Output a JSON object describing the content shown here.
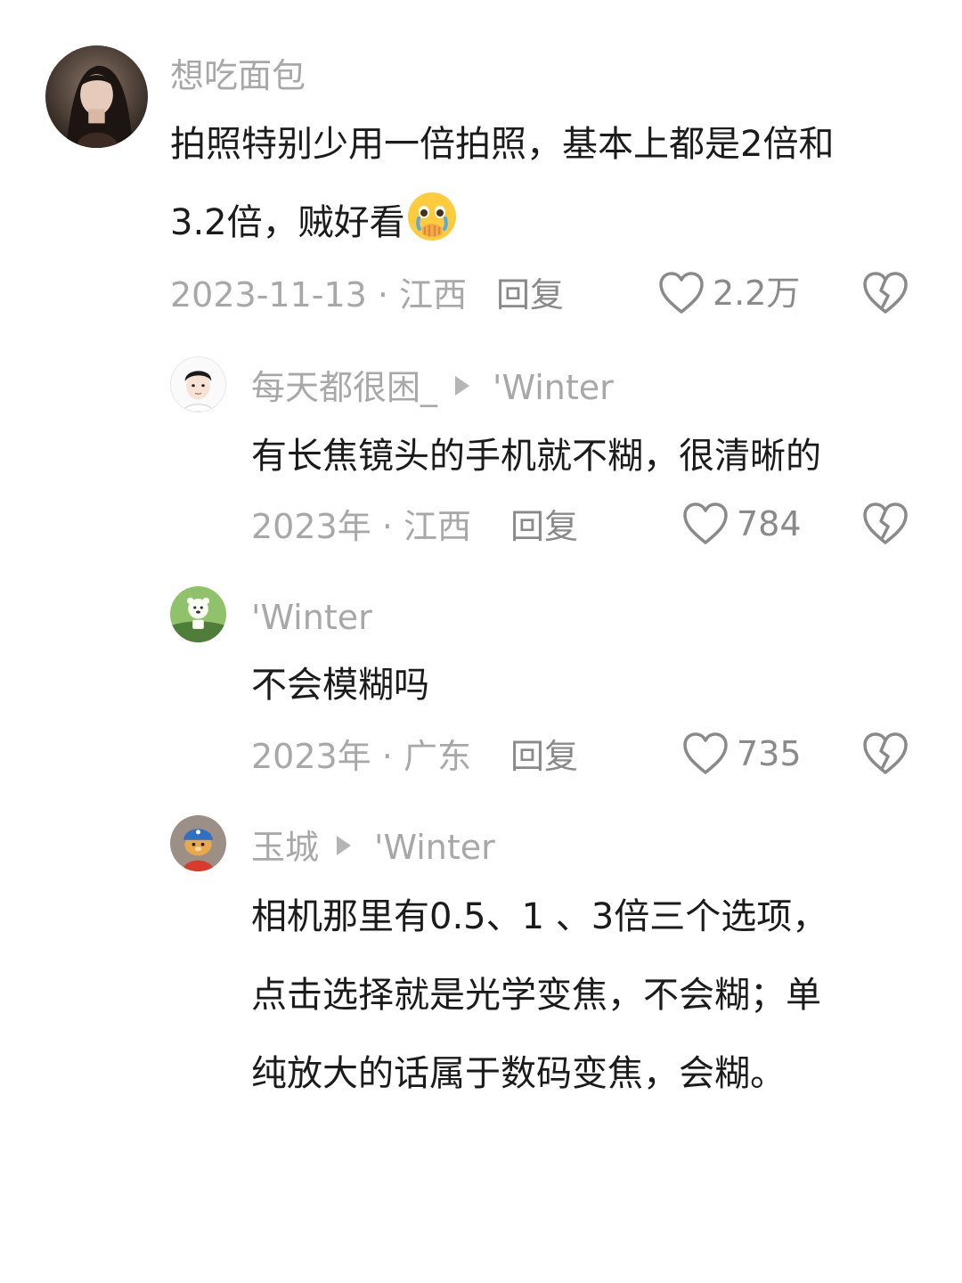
{
  "comments": [
    {
      "username": "想吃面包",
      "text_lines": [
        "拍照特别少用一倍拍照，基本上都是2倍和",
        "3.2倍，贼好看"
      ],
      "date_location": "2023-11-13 · 江西",
      "reply_label": "回复",
      "like_count": "2.2万",
      "emoji": "crying-face-covering-mouth"
    },
    {
      "username": "每天都很困_",
      "reply_to": "'Winter",
      "text_lines": [
        "有长焦镜头的手机就不糊，很清晰的"
      ],
      "date_location": "2023年 · 江西",
      "reply_label": "回复",
      "like_count": "784"
    },
    {
      "username": "'Winter",
      "text_lines": [
        "不会模糊吗"
      ],
      "date_location": "2023年 · 广东",
      "reply_label": "回复",
      "like_count": "735"
    },
    {
      "username": "玉城",
      "reply_to": "'Winter",
      "text_lines": [
        "相机那里有0.5、1 、3倍三个选项，",
        "点击选择就是光学变焦，不会糊；单",
        "纯放大的话属于数码变焦，会糊。"
      ]
    }
  ],
  "icons": {
    "like": "heart-outline-icon",
    "dislike": "broken-heart-icon"
  },
  "colors": {
    "text": "#1b1b1b",
    "secondary": "#a8a8a8",
    "icon": "#8a8a8a"
  }
}
